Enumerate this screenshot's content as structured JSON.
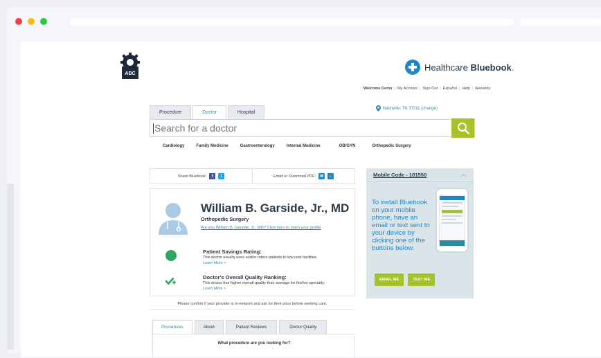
{
  "browser": {
    "dots": [
      "#f2404a",
      "#f6b81c",
      "#28c840"
    ]
  },
  "header": {
    "welcome": "Welcome Demo",
    "links": [
      "My Account",
      "Sign Out",
      "Español",
      "Help",
      "Rewards"
    ],
    "brand_regular": "Healthcare ",
    "brand_bold": "Bluebook",
    "brand_dot": ".",
    "location": "Nashville, TN 37211 (change)"
  },
  "search": {
    "tabs": [
      "Procedure",
      "Doctor",
      "Hospital"
    ],
    "active_tab": "Doctor",
    "placeholder": "Search for a doctor",
    "categories": [
      "Cardiology",
      "Family Medicine",
      "Gastroenterology",
      "Internal Medicine",
      "OB/GYN",
      "Orthopedic Surgery"
    ]
  },
  "share": {
    "share_label": "Share Bluebook:",
    "email_label": "Email or Download PDF:"
  },
  "doctor": {
    "name": "William B. Garside, Jr., MD",
    "specialty": "Orthopedic Surgery",
    "claim": "Are you William B. Garside, Jr., MD? Click here to claim your profile",
    "savings_title": "Patient Savings Rating:",
    "savings_desc": "This doctor usually uses and/or refers patients to low cost facilities.",
    "savings_more": "Learn More >",
    "quality_title": "Doctor's Overall Quality Ranking:",
    "quality_desc": "This doctor has higher overall quality than average for his/her specialty.",
    "quality_more": "Learn More >",
    "confirm": "Please confirm if your provider is in-network and ask for their price before seeking care."
  },
  "lower": {
    "tabs": [
      "Procedures",
      "About",
      "Patient Reviews",
      "Doctor Quality"
    ],
    "active_tab": "Procedures",
    "question": "What procedure are you looking for?"
  },
  "mobile": {
    "title": "Mobile Code - 101550",
    "body": "To install Bluebook on your mobile phone, have an email or text sent to your device by clicking one of the buttons below.",
    "email_btn": "EMAIL ME",
    "text_btn": "TEXT ME"
  },
  "colors": {
    "accent_green": "#a8c22a",
    "teal": "#2a8c9c",
    "blue": "#1f86c8"
  }
}
